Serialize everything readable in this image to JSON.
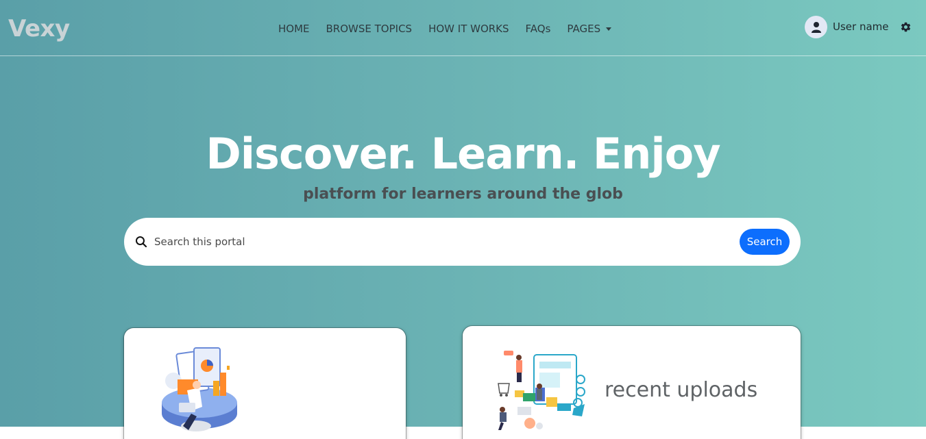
{
  "brand": {
    "name": "Vexy"
  },
  "nav": {
    "items": [
      {
        "label": "HOME"
      },
      {
        "label": "BROWSE TOPICS"
      },
      {
        "label": "HOW IT WORKS"
      },
      {
        "label": "FAQs"
      },
      {
        "label": "PAGES",
        "has_dropdown": true
      }
    ]
  },
  "user": {
    "name": "User name",
    "avatar_icon": "user-icon",
    "settings_icon": "gear-icon"
  },
  "hero": {
    "title": "Discover. Learn. Enjoy",
    "subtitle": "platform for learners around the glob"
  },
  "search": {
    "placeholder": "Search this portal",
    "value": "",
    "button_label": "Search",
    "icon": "search-icon"
  },
  "cards": [
    {
      "title": "",
      "illustration": "analytics-illustration"
    },
    {
      "title": "recent uploads",
      "illustration": "uploads-illustration"
    }
  ],
  "colors": {
    "accent": "#0d6efd",
    "hero_gradient_start": "#5a9fa8",
    "hero_gradient_end": "#7bc9c0",
    "title_text": "#ffffff",
    "subtitle_text": "#4a4f52"
  }
}
